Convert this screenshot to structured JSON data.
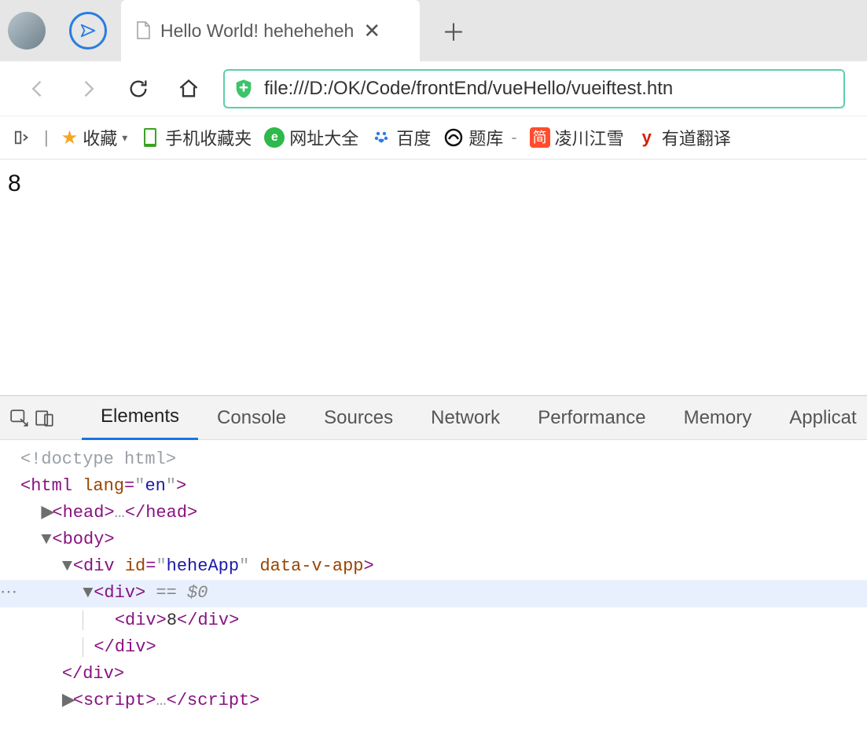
{
  "tab": {
    "title": "Hello World! heheheheh"
  },
  "address": {
    "url": "file:///D:/OK/Code/frontEnd/vueHello/vueiftest.htn"
  },
  "bookmarks": {
    "fav_label": "收藏",
    "items": [
      {
        "label": "手机收藏夹"
      },
      {
        "label": "网址大全"
      },
      {
        "label": "百度"
      },
      {
        "label": "题库"
      },
      {
        "label": "凌川江雪"
      },
      {
        "label": "有道翻译"
      }
    ]
  },
  "page": {
    "content": "8"
  },
  "devtools": {
    "tabs": [
      "Elements",
      "Console",
      "Sources",
      "Network",
      "Performance",
      "Memory",
      "Applicat"
    ],
    "dom": {
      "doctype": "<!doctype html>",
      "html_open": "html",
      "html_lang_attr": "lang",
      "html_lang_val": "en",
      "head": "head",
      "ellipsis": "…",
      "body": "body",
      "div": "div",
      "id_attr": "id",
      "id_val": "heheApp",
      "data_v_app": "data-v-app",
      "selected_marker": " == $0",
      "inner_text": "8",
      "script_tag": "script"
    }
  }
}
